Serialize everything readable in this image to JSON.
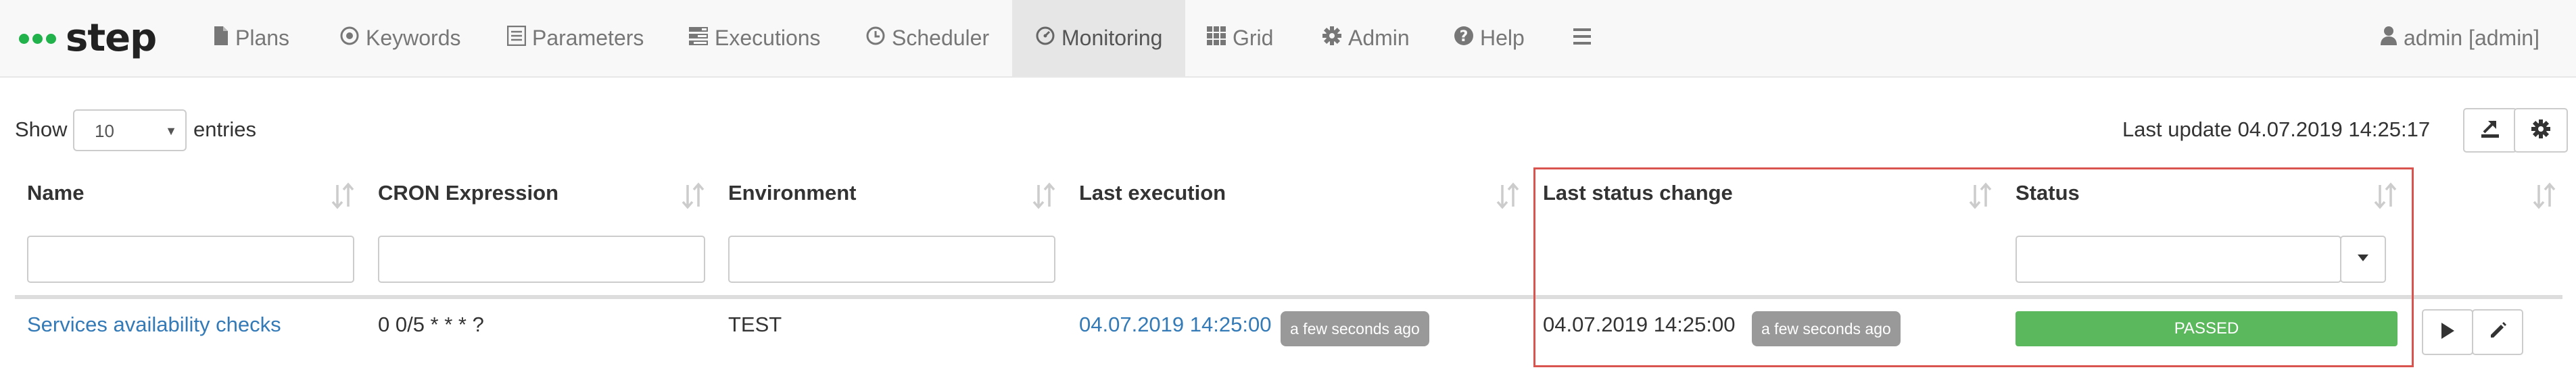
{
  "navbar": {
    "logo_text": "step",
    "items": [
      {
        "label": "Plans",
        "icon": "file-icon"
      },
      {
        "label": "Keywords",
        "icon": "dot-circle-icon"
      },
      {
        "label": "Parameters",
        "icon": "list-icon"
      },
      {
        "label": "Executions",
        "icon": "tasks-icon"
      },
      {
        "label": "Scheduler",
        "icon": "clock-icon"
      },
      {
        "label": "Monitoring",
        "icon": "dashboard-icon",
        "active": true
      },
      {
        "label": "Grid",
        "icon": "grid-icon"
      },
      {
        "label": "Admin",
        "icon": "cog-icon"
      },
      {
        "label": "Help",
        "icon": "question-circle-icon"
      }
    ],
    "user": "admin [admin]",
    "accent": "#22b24c"
  },
  "controls": {
    "show_label": "Show",
    "page_size": "10",
    "entries_label": "entries",
    "last_update": "Last update 04.07.2019 14:25:17"
  },
  "table": {
    "columns": [
      "Name",
      "CRON Expression",
      "Environment",
      "Last execution",
      "Last status change",
      "Status"
    ],
    "rows": [
      {
        "name": "Services availability checks",
        "cron": "0 0/5 * * * ?",
        "environment": "TEST",
        "last_execution": "04.07.2019 14:25:00",
        "last_execution_ago": "a few seconds ago",
        "last_status_change": "04.07.2019 14:25:00",
        "last_status_change_ago": "a few seconds ago",
        "status": "PASSED",
        "status_color": "#5cb85c"
      }
    ]
  },
  "highlight_color": "#d9534f"
}
